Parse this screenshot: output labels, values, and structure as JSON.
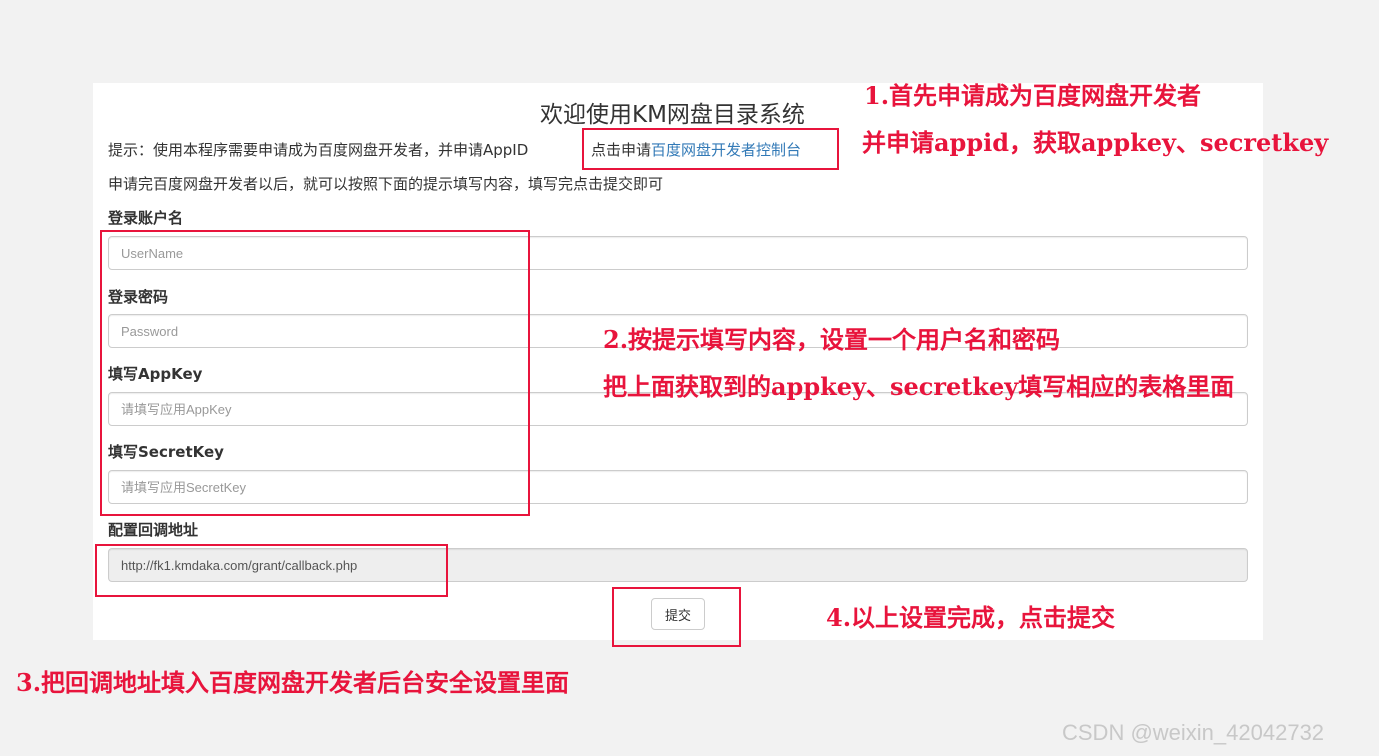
{
  "page": {
    "title": "欢迎使用KM网盘目录系统",
    "hint_line1": "提示：使用本程序需要申请成为百度网盘开发者，并申请AppID",
    "apply_prefix": "点击申请",
    "apply_link": "百度网盘开发者控制台",
    "hint_line2": "申请完百度网盘开发者以后，就可以按照下面的提示填写内容，填写完点击提交即可"
  },
  "form": {
    "username": {
      "label": "登录账户名",
      "placeholder": "UserName"
    },
    "password": {
      "label": "登录密码",
      "placeholder": "Password"
    },
    "appkey": {
      "label": "填写AppKey",
      "placeholder": "请填写应用AppKey"
    },
    "secretkey": {
      "label": "填写SecretKey",
      "placeholder": "请填写应用SecretKey"
    },
    "callback": {
      "label": "配置回调地址",
      "value": "http://fk1.kmdaka.com/grant/callback.php"
    },
    "submit_label": "提交"
  },
  "annotations": {
    "step1_line1": "1.首先申请成为百度网盘开发者",
    "step1_line2": "并申请appid，获取appkey、secretkey",
    "step2_line1": "2.按提示填写内容，设置一个用户名和密码",
    "step2_line2": "把上面获取到的appkey、secretkey填写相应的表格里面",
    "step3": "3.把回调地址填入百度网盘开发者后台安全设置里面",
    "step4": "4.以上设置完成，点击提交"
  },
  "watermark": "CSDN @weixin_42042732",
  "colors": {
    "annotation_red": "#e8143c",
    "link_blue": "#337ab7",
    "readonly_bg": "#eeeeee"
  }
}
